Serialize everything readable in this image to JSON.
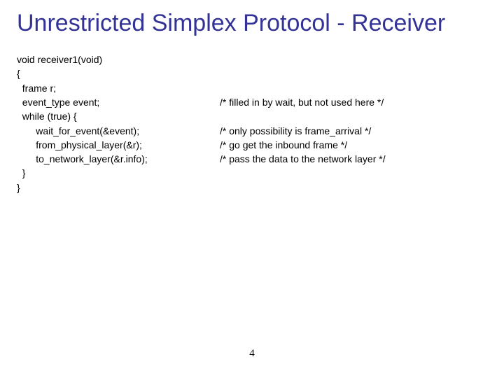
{
  "title": "Unrestricted Simplex Protocol - Receiver",
  "code": {
    "lines": [
      {
        "code": "void receiver1(void)",
        "comment": ""
      },
      {
        "code": "{",
        "comment": ""
      },
      {
        "code": "  frame r;",
        "comment": ""
      },
      {
        "code": "  event_type event;",
        "comment": "/* filled in by wait, but not used here */"
      },
      {
        "code": "",
        "comment": ""
      },
      {
        "code": "  while (true) {",
        "comment": ""
      },
      {
        "code": "       wait_for_event(&event);",
        "comment": "/* only possibility is frame_arrival */"
      },
      {
        "code": "       from_physical_layer(&r);",
        "comment": "/* go get the inbound frame */"
      },
      {
        "code": "       to_network_layer(&r.info);",
        "comment": "/* pass the data to the network layer */"
      },
      {
        "code": "  }",
        "comment": ""
      },
      {
        "code": "}",
        "comment": ""
      }
    ]
  },
  "pageNumber": "4"
}
